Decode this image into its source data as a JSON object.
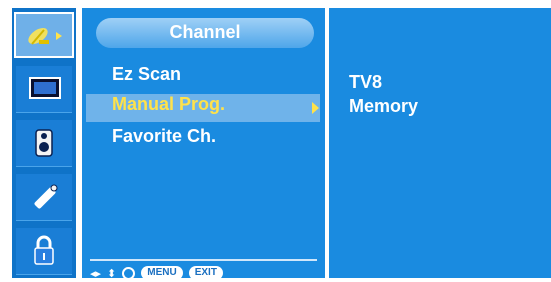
{
  "menu": {
    "title": "Channel",
    "items": [
      "Ez Scan",
      "Manual Prog.",
      "Favorite Ch."
    ]
  },
  "info": {
    "line1": "TV8",
    "line2": "Memory"
  },
  "nav": {
    "menu_label": "MENU",
    "exit_label": "EXIT"
  },
  "icons": [
    "satellite-icon",
    "screen-icon",
    "speaker-icon",
    "pencil-icon",
    "lock-icon"
  ],
  "colors": {
    "panel": "#1a8be0",
    "selected_text": "#ffe24a",
    "icon_column": "#0f73c8"
  }
}
